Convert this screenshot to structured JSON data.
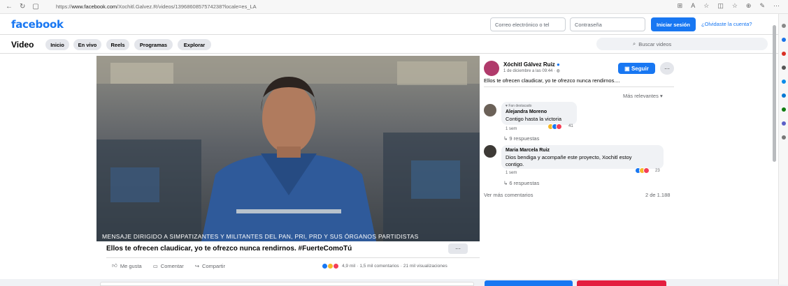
{
  "browser": {
    "url_prefix": "https://",
    "url_domain": "www.facebook.com",
    "url_path": "/Xochitl.Galvez.R/videos/1396860857574238?locale=es_LA"
  },
  "header": {
    "logo": "facebook",
    "email_placeholder": "Correo electrónico o tel",
    "password_placeholder": "Contraseña",
    "login_label": "Iniciar sesión",
    "forgot_label": "¿Olvidaste la cuenta?"
  },
  "video_nav": {
    "title": "Video",
    "tabs": [
      {
        "label": "Inicio"
      },
      {
        "label": "En vivo"
      },
      {
        "label": "Reels"
      },
      {
        "label": "Programas"
      },
      {
        "label": "Explorar"
      }
    ],
    "search_placeholder": "Buscar videos"
  },
  "video": {
    "subtitle": "MENSAJE DIRIGIDO A SIMPATIZANTES Y MILITANTES DEL PAN, PRI, PRD Y SUS ÓRGANOS PARTIDISTAS",
    "title": "Ellos te ofrecen claudicar, yo te ofrezco nunca rendirnos. #FuerteComoTú",
    "more": "···",
    "actions": {
      "like": "Me gusta",
      "comment": "Comentar",
      "share": "Compartir"
    },
    "stats": {
      "reactions": "4,9 mil",
      "comments": "1,5 mil comentarios",
      "views": "21 mil visualizaciones"
    }
  },
  "post": {
    "author": "Xóchitl Gálvez Ruiz",
    "date": "1 de diciembre a las 09:44",
    "follow_label": "Seguir",
    "dots": "···",
    "text": "Ellos te ofrecen claudicar, yo te ofrezco nunca rendirnos....",
    "sort_label": "Más relevantes"
  },
  "comments": [
    {
      "badge": "Fan destacado",
      "author": "Alejandra Moreno",
      "text": "Contigo hasta la victoria",
      "time": "1 sem",
      "reactions": "41",
      "replies": "9 respuestas"
    },
    {
      "author": "Maria Marcela Ruiz",
      "text_line1": "Dios bendiga y acompañe este proyecto, Xochitl estoy",
      "text_line2": "contigo.",
      "time": "1 sem",
      "reactions": "23",
      "replies": "6 respuestas"
    }
  ],
  "comments_footer": {
    "see_more": "Ver más comentarios",
    "pager": "2 de 1.188"
  },
  "colors": {
    "brand": "#1877f2",
    "like_blue": "#1877f2",
    "love_red": "#f33e58",
    "haha_yellow": "#f7b928"
  }
}
